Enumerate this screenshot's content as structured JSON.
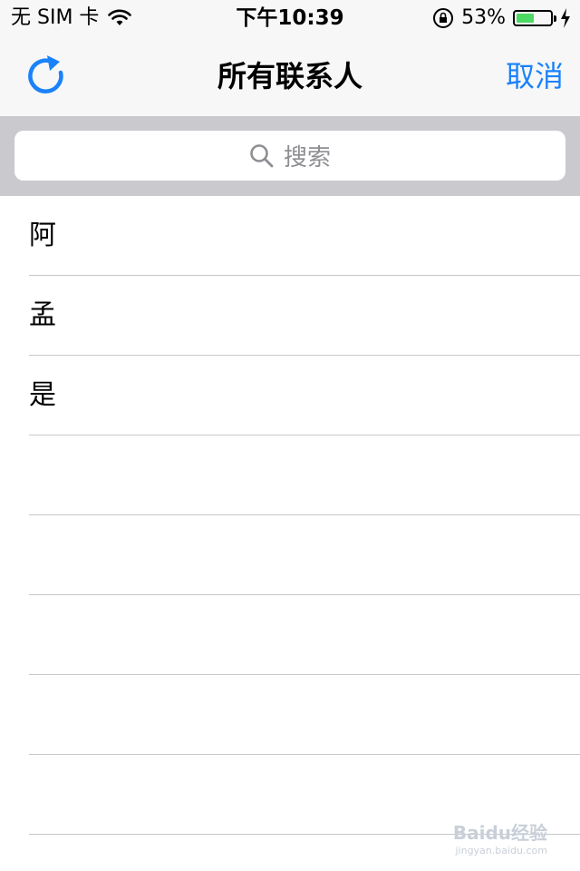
{
  "status_bar": {
    "carrier": "无 SIM 卡",
    "time": "下午10:39",
    "battery_percent": "53%",
    "battery_level": 0.53,
    "battery_color": "#4cd964"
  },
  "nav": {
    "title": "所有联系人",
    "cancel_label": "取消",
    "refresh_icon": "refresh-icon",
    "accent_color": "#1a82fb"
  },
  "search": {
    "placeholder": "搜索"
  },
  "contacts": {
    "items": [
      {
        "name": "阿"
      },
      {
        "name": "孟"
      },
      {
        "name": "是"
      },
      {
        "name": ""
      },
      {
        "name": ""
      },
      {
        "name": ""
      },
      {
        "name": ""
      },
      {
        "name": ""
      }
    ]
  },
  "watermark": {
    "brand": "Baidu经验",
    "url": "jingyan.baidu.com"
  }
}
